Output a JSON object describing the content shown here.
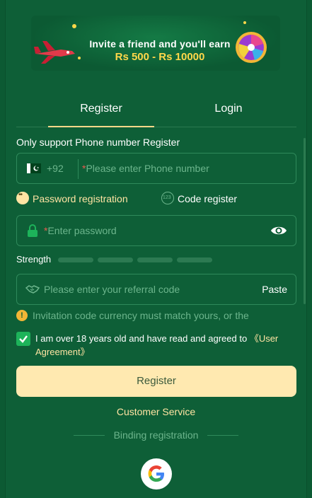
{
  "banner": {
    "line1": "Invite a friend and you'll earn",
    "line2": "Rs 500 - Rs 10000"
  },
  "tabs": [
    {
      "label": "Register",
      "active": true
    },
    {
      "label": "Login",
      "active": false
    }
  ],
  "form": {
    "support_text": "Only support Phone number Register",
    "country_code": "+92",
    "phone_placeholder": "Please enter Phone number",
    "reg_options": [
      {
        "label": "Password registration",
        "active": true
      },
      {
        "label": "Code register",
        "active": false
      }
    ],
    "password_placeholder": "Enter password",
    "strength_label": "Strength",
    "referral_placeholder": "Please enter your referral code",
    "paste_label": "Paste",
    "notice": "Invitation code currency must match yours, or the",
    "agree_text": "I am over 18 years old and have read and agreed to ",
    "agree_link": "《User Agreement》",
    "agree_checked": true,
    "register_button": "Register"
  },
  "footer": {
    "customer_service": "Customer Service",
    "binding": "Binding registration"
  },
  "colors": {
    "background": "#0e5f37",
    "accent": "#ffe9b0",
    "muted": "#6cb58c",
    "check": "#1db35a"
  },
  "icons": {
    "flag": "pakistan-flag-icon",
    "lock": "lock-icon",
    "eye": "eye-icon",
    "handshake": "handshake-icon",
    "warning": "warning-icon",
    "google": "google-icon"
  }
}
